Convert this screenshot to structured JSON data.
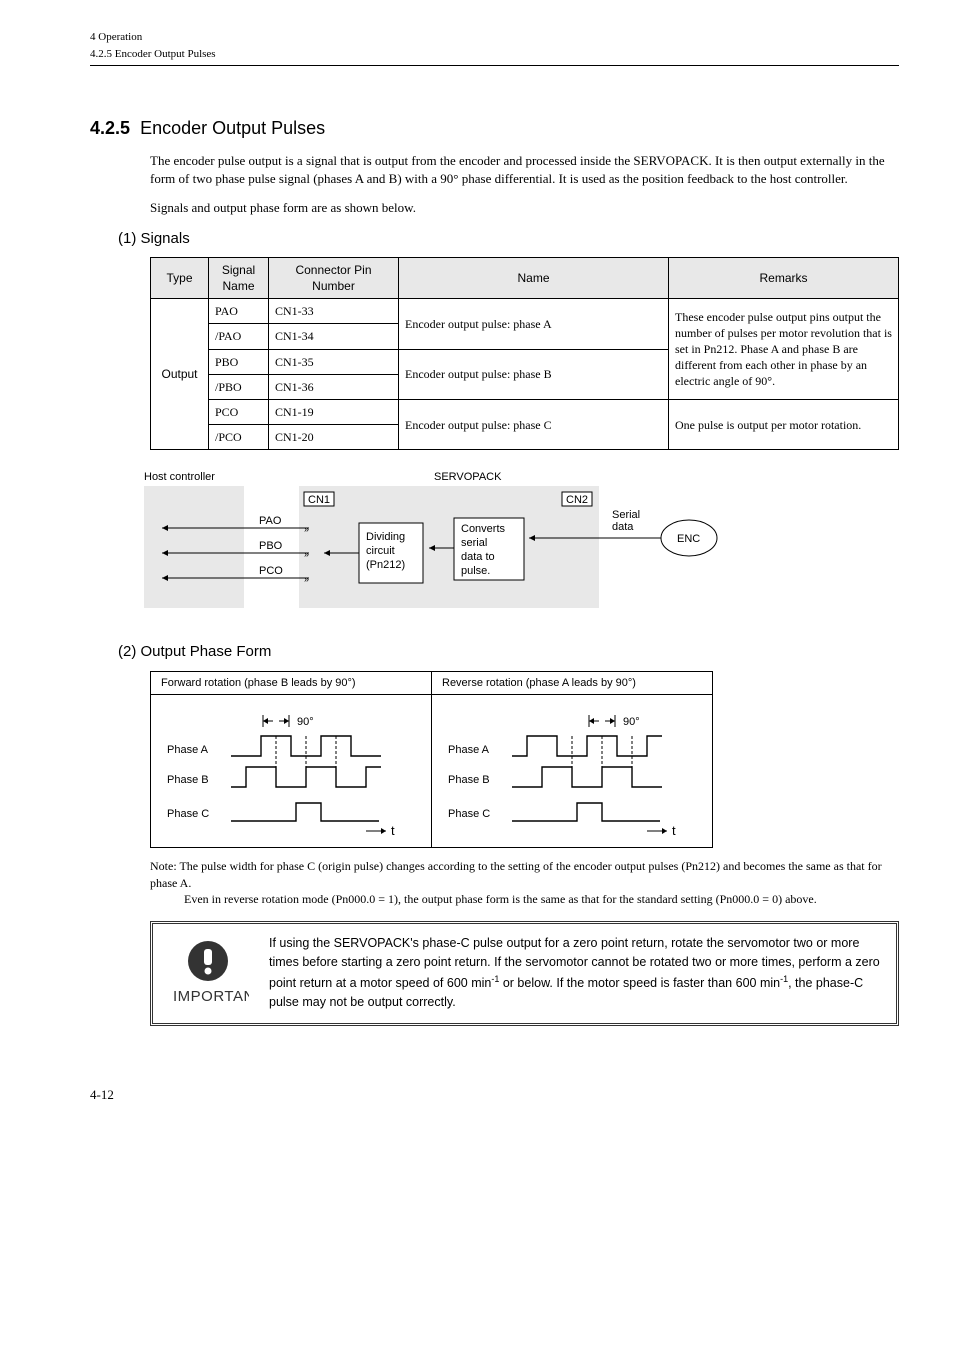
{
  "header": {
    "top": "4  Operation",
    "sub": "4.2.5  Encoder Output Pulses"
  },
  "section": {
    "number": "4.2.5",
    "title": "Encoder Output Pulses",
    "para1": "The encoder pulse output is a signal that is output from the encoder and processed inside the SERVOPACK. It is then output externally in the form of two phase pulse signal (phases A and B) with a 90° phase differential. It is used as the position feedback to the host controller.",
    "para2": "Signals and output phase form are as shown below."
  },
  "signals": {
    "title": "(1)   Signals",
    "headers": {
      "type": "Type",
      "signal": "Signal Name",
      "connector": "Connector Pin Number",
      "name": "Name",
      "remarks": "Remarks"
    },
    "type": "Output",
    "rows": [
      {
        "signal": "PAO",
        "conn": "CN1-33"
      },
      {
        "signal": "/PAO",
        "conn": "CN1-34"
      },
      {
        "signal": "PBO",
        "conn": "CN1-35"
      },
      {
        "signal": "/PBO",
        "conn": "CN1-36"
      },
      {
        "signal": "PCO",
        "conn": "CN1-19"
      },
      {
        "signal": "/PCO",
        "conn": "CN1-20"
      }
    ],
    "names": {
      "a": "Encoder output pulse: phase A",
      "b": "Encoder output pulse: phase B",
      "c": "Encoder output pulse: phase C"
    },
    "remarks": {
      "ab": "These encoder pulse output pins output the number of pulses per motor revolution that is set in Pn212. Phase A and phase B are different from each other in phase by an electric angle of 90°.",
      "c": "One pulse is output per motor rotation."
    }
  },
  "block_diagram": {
    "host": "Host controller",
    "servopack": "SERVOPACK",
    "cn1": "CN1",
    "cn2": "CN2",
    "pao": "PAO",
    "pbo": "PBO",
    "pco": "PCO",
    "divide": "Dividing circuit (Pn212)",
    "convert": "Converts serial data to pulse.",
    "serial": "Serial data",
    "enc": "ENC"
  },
  "phase": {
    "title": "(2)   Output Phase Form",
    "fwd": "Forward rotation (phase B leads by 90°)",
    "rev": "Reverse rotation (phase A leads by 90°)",
    "deg": "90°",
    "a": "Phase A",
    "b": "Phase B",
    "c": "Phase C",
    "t": "t"
  },
  "note": {
    "label": "Note:",
    "line1": "The pulse width for phase C (origin pulse) changes according to the setting of the encoder output pulses (Pn212) and becomes the same as that for phase A.",
    "line2": "Even in reverse rotation mode (Pn000.0 = 1), the output phase form is the same as that for the standard setting (Pn000.0 = 0) above."
  },
  "important": {
    "label": "IMPORTANT",
    "text_a": "If using the SERVOPACK's phase-C pulse output for a zero point return, rotate the servomotor two or more times before starting a zero point return. If the servomotor cannot be rotated two or more times, perform a zero point return at a motor speed of 600 min",
    "text_b": " or below. If the motor speed is faster than 600 min",
    "text_c": ", the phase-C pulse may not be output correctly."
  },
  "page_number": "4-12"
}
